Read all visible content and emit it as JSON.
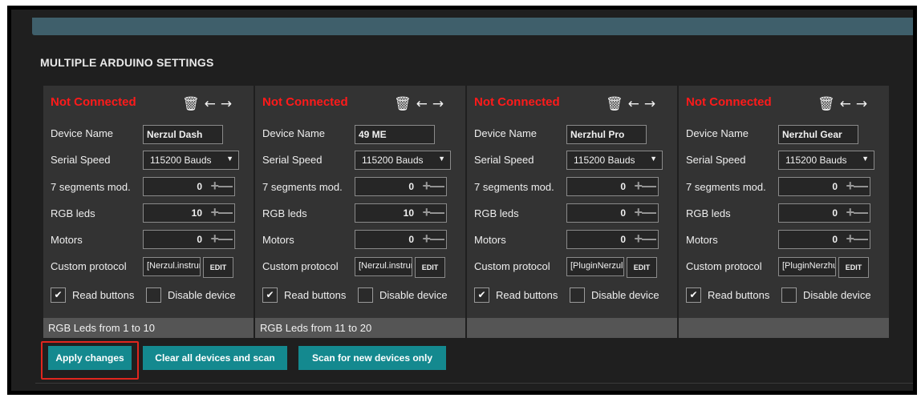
{
  "section_title": "MULTIPLE ARDUINO SETTINGS",
  "labels": {
    "device_name": "Device Name",
    "serial_speed": "Serial Speed",
    "segments": "7 segments mod.",
    "rgb_leds": "RGB leds",
    "motors": "Motors",
    "custom_protocol": "Custom protocol",
    "edit": "EDIT",
    "read_buttons": "Read buttons",
    "disable_device": "Disable device"
  },
  "icons": {
    "delete": "trash-icon",
    "left": "arrow-left-icon",
    "right": "arrow-right-icon"
  },
  "devices": [
    {
      "status": "Not Connected",
      "name": "Nerzul Dash",
      "serial_speed": "115200 Bauds",
      "segments": "0",
      "rgb_leds": "10",
      "motors": "0",
      "protocol": "[Nerzul.instrur",
      "read_buttons": true,
      "disable_device": false,
      "footer": "RGB Leds from 1 to 10"
    },
    {
      "status": "Not Connected",
      "name": "49 ME",
      "serial_speed": "115200 Bauds",
      "segments": "0",
      "rgb_leds": "10",
      "motors": "0",
      "protocol": "[Nerzul.instrur",
      "read_buttons": true,
      "disable_device": false,
      "footer": "RGB Leds from 11 to 20"
    },
    {
      "status": "Not Connected",
      "name": "Nerzhul Pro",
      "serial_speed": "115200 Bauds",
      "segments": "0",
      "rgb_leds": "0",
      "motors": "0",
      "protocol": "[PluginNerzull",
      "read_buttons": true,
      "disable_device": false,
      "footer": ""
    },
    {
      "status": "Not Connected",
      "name": "Nerzhul Gear",
      "serial_speed": "115200 Bauds",
      "segments": "0",
      "rgb_leds": "0",
      "motors": "0",
      "protocol": "[PluginNerzhu",
      "read_buttons": true,
      "disable_device": false,
      "footer": ""
    }
  ],
  "buttons": {
    "apply": "Apply changes",
    "clear": "Clear all devices and scan",
    "scan": "Scan for new devices only"
  },
  "colors": {
    "accent": "#14898f",
    "status": "#ff1a1a",
    "highlight": "#e0261e"
  }
}
